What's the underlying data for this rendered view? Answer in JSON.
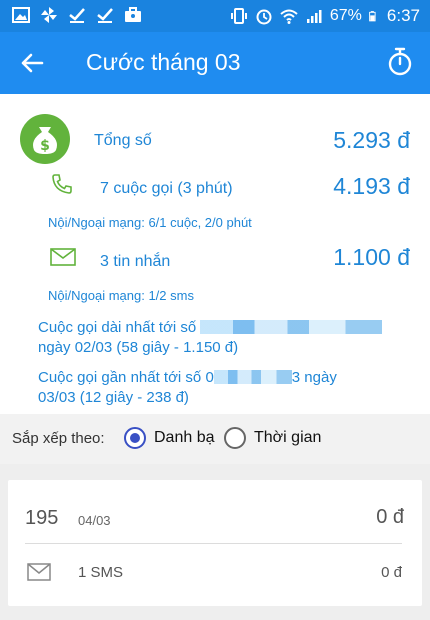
{
  "status_bar": {
    "battery": "67%",
    "time": "6:37",
    "icons": [
      "image-icon",
      "pinwheel-icon",
      "check-icon",
      "check-icon",
      "briefcase-icon",
      "vibrate-icon",
      "alarm-icon",
      "wifi-icon",
      "signal-icon",
      "battery-icon"
    ]
  },
  "app_bar": {
    "title": "Cước tháng 03",
    "back_icon": "arrow-left-icon",
    "timer_icon": "stopwatch-icon"
  },
  "summary": {
    "total_label": "Tổng số",
    "total_value": "5.293 đ",
    "calls_label": "7 cuộc gọi (3 phút)",
    "calls_value": "4.193 đ",
    "calls_note": "Nội/Ngoại mạng: 6/1 cuộc, 2/0 phút",
    "sms_label": "3 tin nhắn",
    "sms_value": "1.100 đ",
    "sms_note": "Nội/Ngoại mạng: 1/2 sms",
    "longest_prefix": "Cuộc gọi dài nhất  tới số",
    "longest_suffix": "ngày 02/03 (58 giây - 1.150 đ)",
    "latest_prefix": "Cuộc gọi gần nhất  tới số 0",
    "latest_mid": "3 ngày",
    "latest_suffix": "03/03 (12 giây - 238 đ)"
  },
  "sort": {
    "label": "Sắp xếp theo:",
    "options": [
      {
        "label": "Danh bạ",
        "selected": true
      },
      {
        "label": "Thời gian",
        "selected": false
      }
    ]
  },
  "card": {
    "number": "195",
    "date": "04/03",
    "total": "0 đ",
    "sms_label": "1 SMS",
    "sms_amount": "0 đ"
  },
  "colors": {
    "appbar": "#1f8cf0",
    "accent_text": "#1f86d6",
    "money_icon": "#62b33c",
    "radio": "#3950c4"
  }
}
